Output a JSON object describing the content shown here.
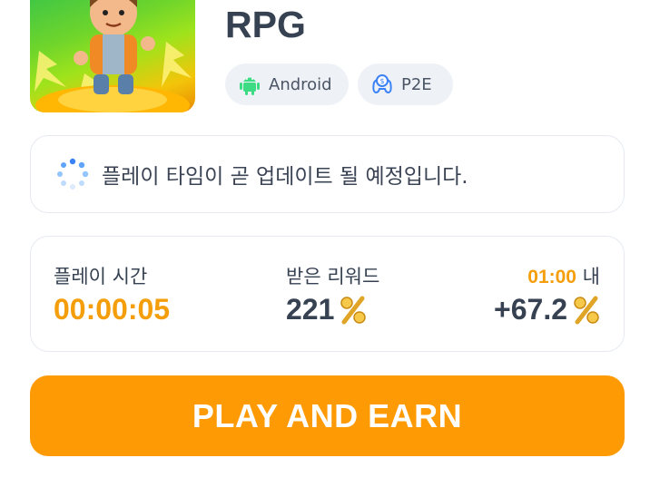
{
  "game": {
    "title": "RPG",
    "thumbnail_icon": "game-character-thumbnail",
    "tags": [
      {
        "label": "Android",
        "icon": "android-icon",
        "color": "#3ddc84"
      },
      {
        "label": "P2E",
        "icon": "p2e-controller-icon",
        "color": "#3b82f6"
      }
    ]
  },
  "notice": {
    "text": "플레이 타임이 곧 업데이트 될 예정입니다.",
    "icon": "loading-spinner-icon"
  },
  "stats": {
    "playtime": {
      "label": "플레이 시간",
      "value": "00:00:05"
    },
    "reward": {
      "label": "받은 리워드",
      "value": "221",
      "icon": "gold-percent-coin-icon"
    },
    "window": {
      "label_accent": "01:00",
      "label_suffix": " 내",
      "value": "+67.2",
      "icon": "gold-percent-coin-icon"
    }
  },
  "cta": {
    "label": "PLAY AND EARN"
  },
  "colors": {
    "accent": "#f59e0b",
    "button": "#fe9a03",
    "text": "#364152",
    "tag_bg": "#eef2f7"
  }
}
